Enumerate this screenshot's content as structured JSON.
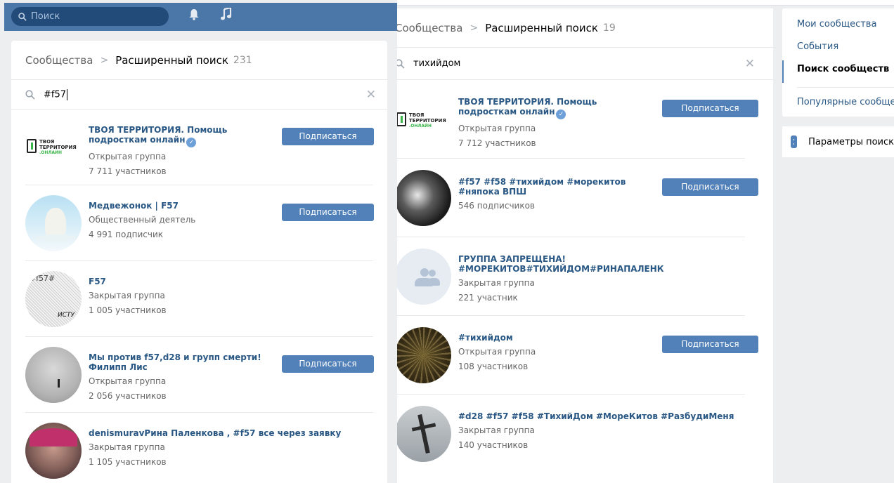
{
  "left": {
    "topbar": {
      "search_placeholder": "Поиск"
    },
    "breadcrumb": {
      "parent": "Сообщества",
      "separator": ">",
      "current": "Расширенный поиск",
      "count": "231"
    },
    "query": "#f57",
    "items": [
      {
        "name": "ТВОЯ ТЕРРИТОРИЯ. Помощь подросткам онлайн",
        "type": "Открытая группа",
        "members": "7 711 участников",
        "button": "Подписаться",
        "logo_line1": "ТВОЯ",
        "logo_line2": "ТЕРРИТОРИЯ",
        "logo_line3": ".ОНЛАЙН"
      },
      {
        "name": "Медвежонок | F57",
        "type": "Общественный деятель",
        "members": "4 991 подписчик",
        "button": "Подписаться"
      },
      {
        "name": "F57",
        "type": "Закрытая группа",
        "members": "1 005 участников",
        "ava_text1": "з#f57#",
        "ava_text2": "ИСТУ"
      },
      {
        "name": "Мы против f57,d28 и групп смерти! Филипп Лис",
        "type": "Открытая группа",
        "members": "2 056 участников",
        "button": "Подписаться"
      },
      {
        "name": "denismuravРина Паленкова , #f57 все через заявку",
        "type": "Закрытая группа",
        "members": "1 105 участников"
      }
    ]
  },
  "right": {
    "breadcrumb": {
      "parent": "Сообщества",
      "separator": ">",
      "current": "Расширенный поиск",
      "count": "19"
    },
    "query": "тихийдом",
    "items": [
      {
        "name": "ТВОЯ ТЕРРИТОРИЯ. Помощь подросткам онлайн",
        "type": "Открытая группа",
        "members": "7 712 участников",
        "button": "Подписаться",
        "logo_line1": "ТВОЯ",
        "logo_line2": "ТЕРРИТОРИЯ",
        "logo_line3": ".ОНЛАЙН"
      },
      {
        "name": "#f57 #f58 #тихийдом #морекитов #няпока ВПШ",
        "members": "546 подписчиков",
        "button": "Подписаться"
      },
      {
        "name": "ГРУППА ЗАПРЕЩЕНА! #МОРЕКИТОВ#ТИХИЙДОМ#РИНАПАЛЕНК",
        "type": "Закрытая группа",
        "members": "221 участник"
      },
      {
        "name": "#тихийдом",
        "type": "Открытая группа",
        "members": "108 участников",
        "button": "Подписаться"
      },
      {
        "name": "#d28 #f57 #f58 #ТихийДом #МореКитов #РазбудиМеня",
        "type": "Закрытая группа",
        "members": "140 участников"
      }
    ],
    "side_menu": [
      "Мои сообщества",
      "События",
      "Поиск сообществ",
      "Популярные сообще"
    ],
    "params_label": "Параметры поиск"
  },
  "icons": {
    "search": "search-icon",
    "clear": "close-icon",
    "bell": "bell-icon",
    "music": "music-icon",
    "verified": "verified-icon",
    "params": "sliders-icon"
  },
  "colors": {
    "topbar": "#4a76a8",
    "button": "#5181b8",
    "link": "#2a5885",
    "verified": "#6d9fd9"
  }
}
